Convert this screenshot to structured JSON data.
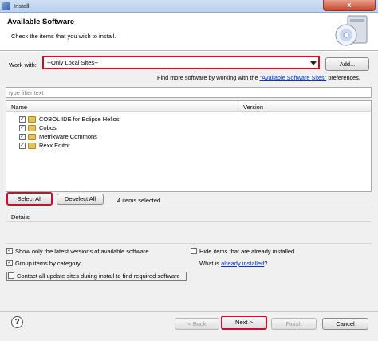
{
  "window": {
    "title": "Install",
    "close_glyph": "x"
  },
  "banner": {
    "title": "Available Software",
    "subtitle": "Check the items that you wish to install."
  },
  "workwith": {
    "label": "Work with:",
    "value": "--Only Local Sites--",
    "add_label": "Add...",
    "find_more_prefix": "Find more software by working with the ",
    "find_more_link": "\"Available Software Sites\"",
    "find_more_suffix": " preferences."
  },
  "filter": {
    "placeholder": "type filter text"
  },
  "tree": {
    "columns": {
      "name": "Name",
      "version": "Version"
    },
    "items": [
      {
        "label": "COBOL IDE for Eclipse Helios",
        "checked": true
      },
      {
        "label": "Cobos",
        "checked": true
      },
      {
        "label": "Metrixware Commons",
        "checked": true
      },
      {
        "label": "Rexx Editor",
        "checked": true
      }
    ]
  },
  "selection": {
    "select_all": "Select All",
    "deselect_all": "Deselect All",
    "count_text": "4 items selected"
  },
  "details": {
    "label": "Details"
  },
  "options": {
    "latest": "Show only the latest versions of available software",
    "group": "Group items by category",
    "contact": "Contact all update sites during install to find required software",
    "hide_installed": "Hide items that are already installed",
    "what_is_prefix": "What is ",
    "what_is_link": "already installed",
    "what_is_suffix": "?"
  },
  "footer": {
    "help": "?",
    "back": "< Back",
    "next": "Next >",
    "finish": "Finish",
    "cancel": "Cancel"
  },
  "colors": {
    "highlight": "#c8102e",
    "link": "#0033cc"
  }
}
